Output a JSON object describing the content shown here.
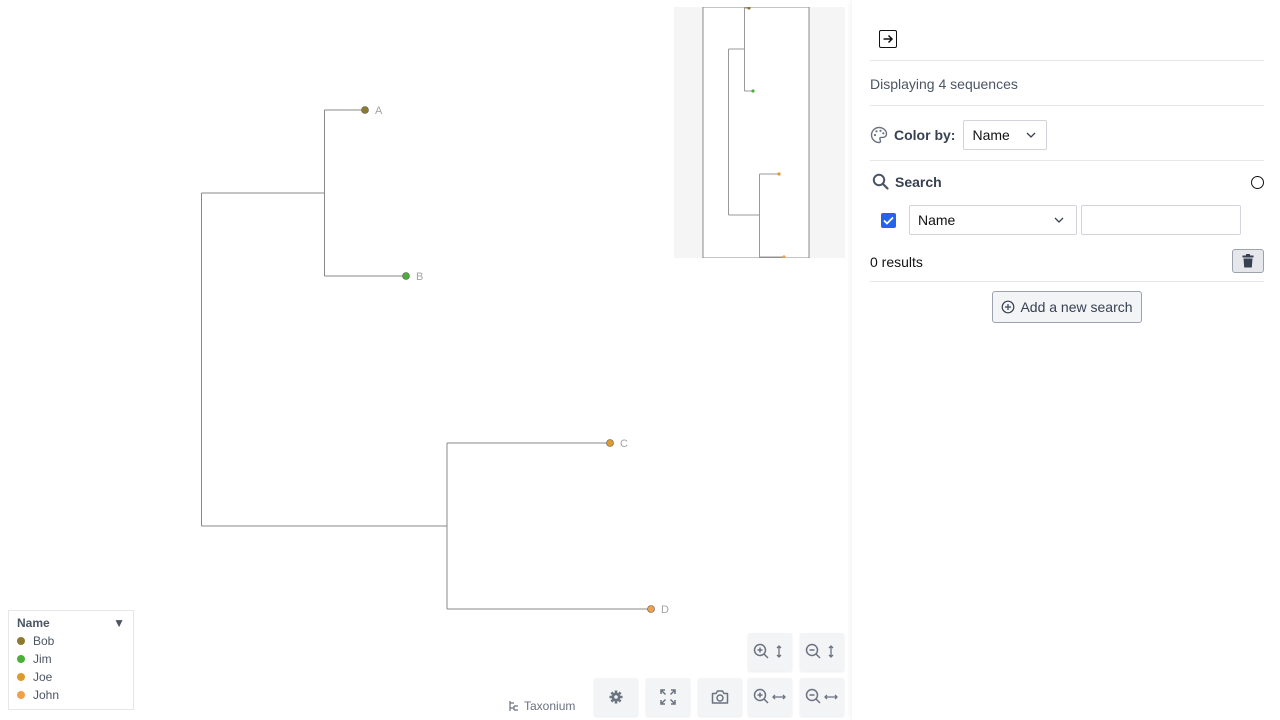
{
  "tree": {
    "leaves": [
      {
        "label": "A",
        "name": "Bob",
        "color": "#8c7a2e"
      },
      {
        "label": "B",
        "name": "Jim",
        "color": "#4caf3a"
      },
      {
        "label": "C",
        "name": "Joe",
        "color": "#e09a2c"
      },
      {
        "label": "D",
        "name": "John",
        "color": "#f0a04b"
      }
    ]
  },
  "legend": {
    "title": "Name",
    "toggle": "▼",
    "items": [
      {
        "label": "Bob",
        "color": "#8c7a2e"
      },
      {
        "label": "Jim",
        "color": "#4caf3a"
      },
      {
        "label": "Joe",
        "color": "#e09a2c"
      },
      {
        "label": "John",
        "color": "#f0a04b"
      }
    ]
  },
  "brand": {
    "name": "Taxonium"
  },
  "controls": {
    "zoom_in_vertical": "zoom-in-vertical",
    "zoom_out_vertical": "zoom-out-vertical",
    "zoom_in_horizontal": "zoom-in-horizontal",
    "zoom_out_horizontal": "zoom-out-horizontal",
    "settings": "gear-icon",
    "fullscreen": "expand-icon",
    "screenshot": "camera-icon"
  },
  "panel": {
    "sequence_count": "Displaying 4 sequences",
    "color_by": {
      "label": "Color by:",
      "value": "Name"
    },
    "search": {
      "label": "Search",
      "field_value": "Name",
      "text_value": "",
      "checked": true,
      "results": "0 results"
    },
    "add_search_label": "Add a new search"
  },
  "colors": {
    "accent": "#2563eb",
    "branch": "#888888"
  }
}
